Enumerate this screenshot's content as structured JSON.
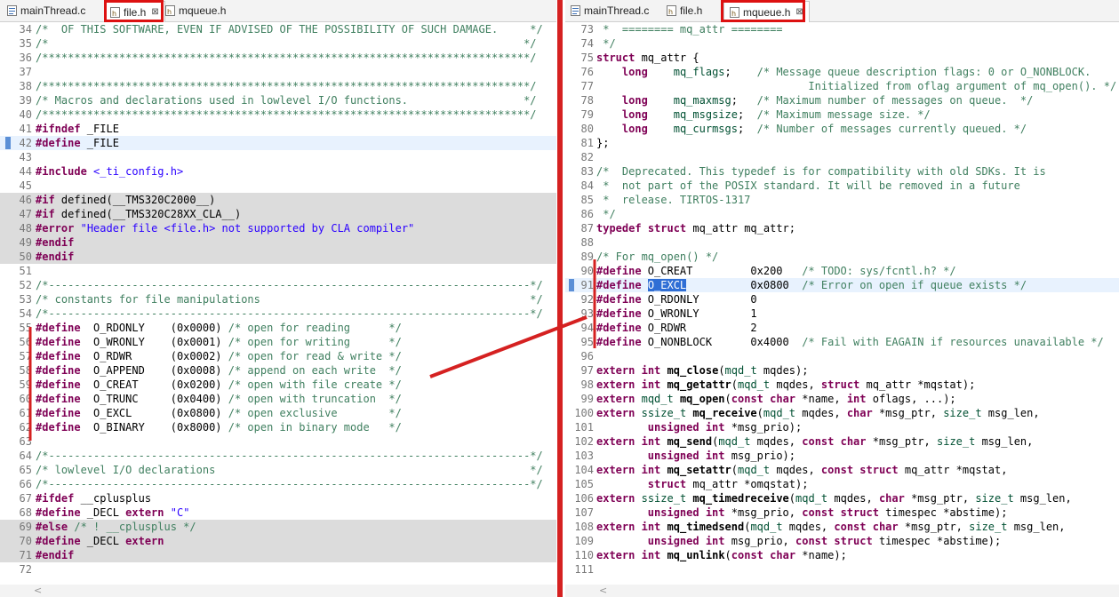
{
  "colors": {
    "annotation": "#d52121",
    "comment": "#3f7f5f",
    "keyword": "#7f0055",
    "string": "#2a00ff",
    "gray_block": "#dcdcdc"
  },
  "left": {
    "tabs": [
      {
        "label": "mainThread.c",
        "icon": "c-source-file-icon",
        "active": false
      },
      {
        "label": "file.h",
        "icon": "c-header-file-icon",
        "active": true,
        "close": "⊠"
      },
      {
        "label": "mqueue.h",
        "icon": "c-header-file-icon",
        "active": false
      }
    ],
    "lines": [
      {
        "n": "34",
        "h": "<span class=\"c\">/*  OF THIS SOFTWARE, EVEN IF ADVISED OF THE POSSIBILITY OF SUCH DAMAGE.     */</span>"
      },
      {
        "n": "35",
        "h": "<span class=\"c\">/*                                                                          */</span>"
      },
      {
        "n": "36",
        "h": "<span class=\"c\">/****************************************************************************/</span>"
      },
      {
        "n": "37",
        "h": ""
      },
      {
        "n": "38",
        "h": "<span class=\"c\">/****************************************************************************/</span>"
      },
      {
        "n": "39",
        "h": "<span class=\"c\">/* Macros and declarations used in lowlevel I/O functions.                  */</span>"
      },
      {
        "n": "40",
        "h": "<span class=\"c\">/****************************************************************************/</span>"
      },
      {
        "n": "41",
        "h": "<span class=\"p\">#ifndef</span> _FILE"
      },
      {
        "n": "42",
        "h": "<span class=\"p\">#define</span> _FILE",
        "bg": "sel",
        "marker": true
      },
      {
        "n": "43",
        "h": ""
      },
      {
        "n": "44",
        "h": "<span class=\"p\">#include</span> <span class=\"s\">&lt;_ti_config.h&gt;</span>"
      },
      {
        "n": "45",
        "h": ""
      },
      {
        "n": "46",
        "h": "<span class=\"p\">#if</span> defined(__TMS320C2000__)",
        "bg": "gray"
      },
      {
        "n": "47",
        "h": "<span class=\"p\">#if</span> defined(__TMS320C28XX_CLA__)",
        "bg": "gray"
      },
      {
        "n": "48",
        "h": "<span class=\"p\">#error</span> <span class=\"s\">\"Header file &lt;file.h&gt; not supported by CLA compiler\"</span>",
        "bg": "gray"
      },
      {
        "n": "49",
        "h": "<span class=\"p\">#endif</span>",
        "bg": "gray"
      },
      {
        "n": "50",
        "h": "<span class=\"p\">#endif</span>",
        "bg": "gray"
      },
      {
        "n": "51",
        "h": ""
      },
      {
        "n": "52",
        "h": "<span class=\"c\">/*---------------------------------------------------------------------------*/</span>"
      },
      {
        "n": "53",
        "h": "<span class=\"c\">/* constants for file manipulations                                          */</span>"
      },
      {
        "n": "54",
        "h": "<span class=\"c\">/*---------------------------------------------------------------------------*/</span>"
      },
      {
        "n": "55",
        "h": "<span class=\"p\">#define</span>  O_RDONLY    (0x0000) <span class=\"c\">/* open for reading      */</span>"
      },
      {
        "n": "56",
        "h": "<span class=\"p\">#define</span>  O_WRONLY    (0x0001) <span class=\"c\">/* open for writing      */</span>"
      },
      {
        "n": "57",
        "h": "<span class=\"p\">#define</span>  O_RDWR      (0x0002) <span class=\"c\">/* open for read &amp; write */</span>"
      },
      {
        "n": "58",
        "h": "<span class=\"p\">#define</span>  O_APPEND    (0x0008) <span class=\"c\">/* append on each write  */</span>"
      },
      {
        "n": "59",
        "h": "<span class=\"p\">#define</span>  O_CREAT     (0x0200) <span class=\"c\">/* open with file create */</span>"
      },
      {
        "n": "60",
        "h": "<span class=\"p\">#define</span>  O_TRUNC     (0x0400) <span class=\"c\">/* open with truncation  */</span>"
      },
      {
        "n": "61",
        "h": "<span class=\"p\">#define</span>  O_EXCL      (0x0800) <span class=\"c\">/* open exclusive        */</span>"
      },
      {
        "n": "62",
        "h": "<span class=\"p\">#define</span>  O_BINARY    (0x8000) <span class=\"c\">/* open in binary mode   */</span>"
      },
      {
        "n": "63",
        "h": ""
      },
      {
        "n": "64",
        "h": "<span class=\"c\">/*---------------------------------------------------------------------------*/</span>"
      },
      {
        "n": "65",
        "h": "<span class=\"c\">/* lowlevel I/O declarations                                                 */</span>"
      },
      {
        "n": "66",
        "h": "<span class=\"c\">/*---------------------------------------------------------------------------*/</span>"
      },
      {
        "n": "67",
        "h": "<span class=\"p\">#ifdef</span> __cplusplus"
      },
      {
        "n": "68",
        "h": "<span class=\"p\">#define</span> _DECL <span class=\"k\">extern</span> <span class=\"s\">\"C\"</span>"
      },
      {
        "n": "69",
        "h": "<span class=\"p\">#else</span> <span class=\"c\">/* ! __cplusplus */</span>",
        "bg": "gray"
      },
      {
        "n": "70",
        "h": "<span class=\"p\">#define</span> _DECL <span class=\"k\">extern</span>",
        "bg": "gray"
      },
      {
        "n": "71",
        "h": "<span class=\"p\">#endif</span>",
        "bg": "gray"
      },
      {
        "n": "72",
        "h": ""
      }
    ],
    "scroll_arrow": "<"
  },
  "right": {
    "tabs": [
      {
        "label": "mainThread.c",
        "icon": "c-source-file-icon",
        "active": false
      },
      {
        "label": "file.h",
        "icon": "c-header-file-icon",
        "active": false
      },
      {
        "label": "mqueue.h",
        "icon": "c-header-file-icon",
        "active": true,
        "close": "⊠"
      }
    ],
    "lines": [
      {
        "n": "73",
        "h": "<span class=\"c\"> *  ======== mq_attr ========</span>"
      },
      {
        "n": "74",
        "h": "<span class=\"c\"> */</span>"
      },
      {
        "n": "75",
        "h": "<span class=\"k\">struct</span> mq_attr {"
      },
      {
        "n": "76",
        "h": "    <span class=\"k\">long</span>    <span class=\"t\">mq_flags</span>;    <span class=\"c\">/* Message queue description flags: 0 or O_NONBLOCK.</span>"
      },
      {
        "n": "77",
        "h": "<span class=\"c\">                                 Initialized from oflag argument of mq_open(). */</span>"
      },
      {
        "n": "78",
        "h": "    <span class=\"k\">long</span>    <span class=\"t\">mq_maxmsg</span>;   <span class=\"c\">/* Maximum number of messages on queue.  */</span>"
      },
      {
        "n": "79",
        "h": "    <span class=\"k\">long</span>    <span class=\"t\">mq_msgsize</span>;  <span class=\"c\">/* Maximum message size. */</span>"
      },
      {
        "n": "80",
        "h": "    <span class=\"k\">long</span>    <span class=\"t\">mq_curmsgs</span>;  <span class=\"c\">/* Number of messages currently queued. */</span>"
      },
      {
        "n": "81",
        "h": "};"
      },
      {
        "n": "82",
        "h": ""
      },
      {
        "n": "83",
        "h": "<span class=\"c\">/*  Deprecated. This typedef is for compatibility with old SDKs. It is</span>"
      },
      {
        "n": "84",
        "h": "<span class=\"c\"> *  not part of the POSIX standard. It will be removed in a future</span>"
      },
      {
        "n": "85",
        "h": "<span class=\"c\"> *  release. TIRTOS-1317</span>"
      },
      {
        "n": "86",
        "h": "<span class=\"c\"> */</span>"
      },
      {
        "n": "87",
        "h": "<span class=\"k\">typedef</span> <span class=\"k\">struct</span> mq_attr mq_attr;"
      },
      {
        "n": "88",
        "h": ""
      },
      {
        "n": "89",
        "h": "<span class=\"c\">/* For mq_open() */</span>"
      },
      {
        "n": "90",
        "h": "<span class=\"p\">#define</span> O_CREAT         0x200   <span class=\"c\">/* TODO: sys/fcntl.h? */</span>"
      },
      {
        "n": "91",
        "h": "<span class=\"p\">#define</span> <span class=\"selw\">O_EXCL</span>          0x0800  <span class=\"c\">/* Error on open if queue exists */</span>",
        "bg": "sel",
        "marker": true
      },
      {
        "n": "92",
        "h": "<span class=\"p\">#define</span> O_RDONLY        0"
      },
      {
        "n": "93",
        "h": "<span class=\"p\">#define</span> O_WRONLY        1"
      },
      {
        "n": "94",
        "h": "<span class=\"p\">#define</span> O_RDWR          2"
      },
      {
        "n": "95",
        "h": "<span class=\"p\">#define</span> O_NONBLOCK      0x4000  <span class=\"c\">/* Fail with EAGAIN if resources unavailable */</span>"
      },
      {
        "n": "96",
        "h": ""
      },
      {
        "n": "97",
        "h": "<span class=\"k\">extern</span> <span class=\"k\">int</span> <span class=\"f\">mq_close</span>(<span class=\"t\">mqd_t</span> mqdes);"
      },
      {
        "n": "98",
        "h": "<span class=\"k\">extern</span> <span class=\"k\">int</span> <span class=\"f\">mq_getattr</span>(<span class=\"t\">mqd_t</span> mqdes, <span class=\"k\">struct</span> mq_attr *mqstat);"
      },
      {
        "n": "99",
        "h": "<span class=\"k\">extern</span> <span class=\"t\">mqd_t</span> <span class=\"f\">mq_open</span>(<span class=\"k\">const</span> <span class=\"k\">char</span> *name, <span class=\"k\">int</span> oflags, ...);"
      },
      {
        "n": "100",
        "h": "<span class=\"k\">extern</span> <span class=\"t\">ssize_t</span> <span class=\"f\">mq_receive</span>(<span class=\"t\">mqd_t</span> mqdes, <span class=\"k\">char</span> *msg_ptr, <span class=\"t\">size_t</span> msg_len,"
      },
      {
        "n": "101",
        "h": "        <span class=\"k\">unsigned</span> <span class=\"k\">int</span> *msg_prio);"
      },
      {
        "n": "102",
        "h": "<span class=\"k\">extern</span> <span class=\"k\">int</span> <span class=\"f\">mq_send</span>(<span class=\"t\">mqd_t</span> mqdes, <span class=\"k\">const</span> <span class=\"k\">char</span> *msg_ptr, <span class=\"t\">size_t</span> msg_len,"
      },
      {
        "n": "103",
        "h": "        <span class=\"k\">unsigned</span> <span class=\"k\">int</span> msg_prio);"
      },
      {
        "n": "104",
        "h": "<span class=\"k\">extern</span> <span class=\"k\">int</span> <span class=\"f\">mq_setattr</span>(<span class=\"t\">mqd_t</span> mqdes, <span class=\"k\">const</span> <span class=\"k\">struct</span> mq_attr *mqstat,"
      },
      {
        "n": "105",
        "h": "        <span class=\"k\">struct</span> mq_attr *omqstat);"
      },
      {
        "n": "106",
        "h": "<span class=\"k\">extern</span> <span class=\"t\">ssize_t</span> <span class=\"f\">mq_timedreceive</span>(<span class=\"t\">mqd_t</span> mqdes, <span class=\"k\">char</span> *msg_ptr, <span class=\"t\">size_t</span> msg_len,"
      },
      {
        "n": "107",
        "h": "        <span class=\"k\">unsigned</span> <span class=\"k\">int</span> *msg_prio, <span class=\"k\">const</span> <span class=\"k\">struct</span> timespec *abstime);"
      },
      {
        "n": "108",
        "h": "<span class=\"k\">extern</span> <span class=\"k\">int</span> <span class=\"f\">mq_timedsend</span>(<span class=\"t\">mqd_t</span> mqdes, <span class=\"k\">const</span> <span class=\"k\">char</span> *msg_ptr, <span class=\"t\">size_t</span> msg_len,"
      },
      {
        "n": "109",
        "h": "        <span class=\"k\">unsigned</span> <span class=\"k\">int</span> msg_prio, <span class=\"k\">const</span> <span class=\"k\">struct</span> timespec *abstime);"
      },
      {
        "n": "110",
        "h": "<span class=\"k\">extern</span> <span class=\"k\">int</span> <span class=\"f\">mq_unlink</span>(<span class=\"k\">const</span> <span class=\"k\">char</span> *name);"
      },
      {
        "n": "111",
        "h": ""
      }
    ],
    "scroll_arrow": "<"
  }
}
